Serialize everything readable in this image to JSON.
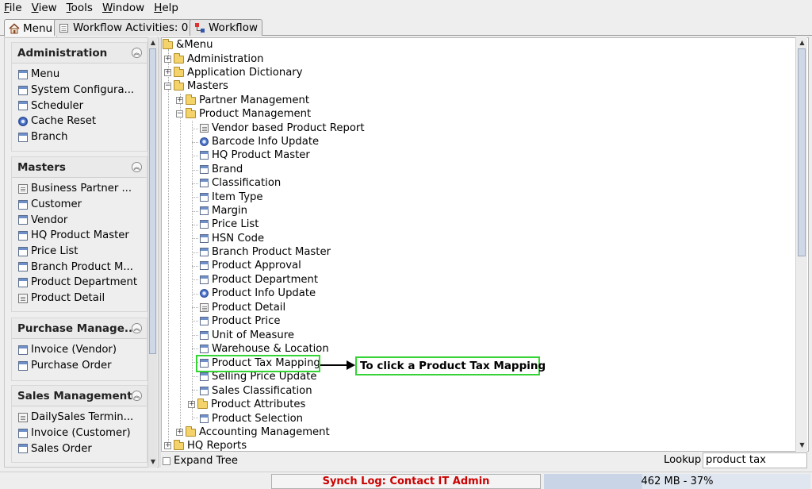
{
  "menubar": {
    "items": [
      {
        "label": "File",
        "mnemonic": "F"
      },
      {
        "label": "View",
        "mnemonic": "V"
      },
      {
        "label": "Tools",
        "mnemonic": "T"
      },
      {
        "label": "Window",
        "mnemonic": "W"
      },
      {
        "label": "Help",
        "mnemonic": "H"
      }
    ]
  },
  "tabs": [
    {
      "label": "Menu",
      "icon": "home-icon",
      "active": true
    },
    {
      "label": "Workflow Activities: 0",
      "icon": "window-icon",
      "active": false
    },
    {
      "label": "Workflow",
      "icon": "workflow-icon",
      "active": false
    }
  ],
  "left_panel": {
    "groups": [
      {
        "title": "Administration",
        "items": [
          {
            "label": "Menu",
            "icon": "window-icon"
          },
          {
            "label": "System Configura...",
            "icon": "window-icon"
          },
          {
            "label": "Scheduler",
            "icon": "window-icon"
          },
          {
            "label": "Cache Reset",
            "icon": "gear-icon"
          },
          {
            "label": "Branch",
            "icon": "window-icon"
          }
        ]
      },
      {
        "title": "Masters",
        "items": [
          {
            "label": "Business Partner ...",
            "icon": "document-icon"
          },
          {
            "label": "Customer",
            "icon": "window-icon"
          },
          {
            "label": "Vendor",
            "icon": "window-icon"
          },
          {
            "label": "HQ Product Master",
            "icon": "window-icon"
          },
          {
            "label": "Price List",
            "icon": "window-icon"
          },
          {
            "label": "Branch Product M...",
            "icon": "window-icon"
          },
          {
            "label": "Product Department",
            "icon": "window-icon"
          },
          {
            "label": "Product Detail",
            "icon": "document-icon"
          }
        ]
      },
      {
        "title": "Purchase Manage...",
        "items": [
          {
            "label": "Invoice (Vendor)",
            "icon": "window-icon"
          },
          {
            "label": "Purchase Order",
            "icon": "window-icon"
          }
        ]
      },
      {
        "title": "Sales Management",
        "items": [
          {
            "label": "DailySales Termin...",
            "icon": "document-icon"
          },
          {
            "label": "Invoice (Customer)",
            "icon": "window-icon"
          },
          {
            "label": "Sales Order",
            "icon": "window-icon"
          }
        ]
      }
    ]
  },
  "tree": {
    "root": "&Menu",
    "nodes": [
      {
        "label": "Administration",
        "type": "folder",
        "state": "collapsed",
        "level": 1
      },
      {
        "label": "Application Dictionary",
        "type": "folder",
        "state": "collapsed",
        "level": 1
      },
      {
        "label": "Masters",
        "type": "folder",
        "state": "expanded",
        "level": 1
      },
      {
        "label": "Partner Management",
        "type": "folder",
        "state": "collapsed",
        "level": 2
      },
      {
        "label": "Product Management",
        "type": "folder",
        "state": "expanded",
        "level": 2
      },
      {
        "label": "Vendor based Product Report",
        "type": "document",
        "level": 3
      },
      {
        "label": "Barcode Info Update",
        "type": "gear",
        "level": 3
      },
      {
        "label": "HQ Product Master",
        "type": "window",
        "level": 3
      },
      {
        "label": "Brand",
        "type": "window",
        "level": 3
      },
      {
        "label": "Classification",
        "type": "window",
        "level": 3
      },
      {
        "label": "Item Type",
        "type": "window",
        "level": 3
      },
      {
        "label": "Margin",
        "type": "window",
        "level": 3
      },
      {
        "label": "Price List",
        "type": "window",
        "level": 3
      },
      {
        "label": "HSN Code",
        "type": "window",
        "level": 3
      },
      {
        "label": "Branch Product Master",
        "type": "window",
        "level": 3
      },
      {
        "label": "Product Approval",
        "type": "window",
        "level": 3
      },
      {
        "label": "Product Department",
        "type": "window",
        "level": 3
      },
      {
        "label": "Product Info Update",
        "type": "gear",
        "level": 3
      },
      {
        "label": "Product Detail",
        "type": "document",
        "level": 3
      },
      {
        "label": "Product Price",
        "type": "window",
        "level": 3
      },
      {
        "label": "Unit of Measure",
        "type": "window",
        "level": 3
      },
      {
        "label": "Warehouse & Location",
        "type": "window",
        "level": 3
      },
      {
        "label": "Product Tax Mapping",
        "type": "window",
        "level": 3,
        "highlighted": true
      },
      {
        "label": "Selling Price Update",
        "type": "window",
        "level": 3
      },
      {
        "label": "Sales Classification",
        "type": "window",
        "level": 3
      },
      {
        "label": "Product Attributes",
        "type": "folder",
        "state": "collapsed",
        "level": 3
      },
      {
        "label": "Product Selection",
        "type": "window",
        "level": 3
      },
      {
        "label": "Accounting Management",
        "type": "folder",
        "state": "collapsed",
        "level": 2
      },
      {
        "label": "HQ Reports",
        "type": "folder",
        "state": "collapsed",
        "level": 1
      }
    ]
  },
  "annotation": {
    "callout_text": "To click a Product Tax Mapping",
    "color": "#35d435"
  },
  "bottom": {
    "expand_tree_label": "Expand Tree",
    "lookup_label": "Lookup",
    "lookup_value": "product tax"
  },
  "status": {
    "synch_text": "Synch Log: Contact IT Admin",
    "memory_text": "462 MB - 37%",
    "memory_fraction": 0.37
  }
}
